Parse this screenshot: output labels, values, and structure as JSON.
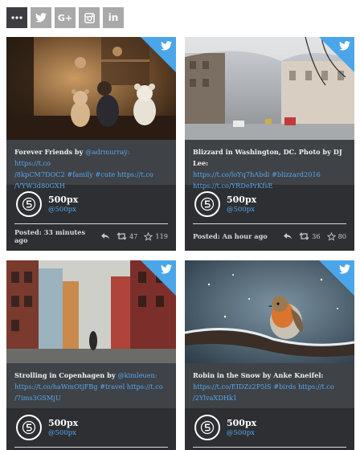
{
  "filters": [
    {
      "icon": "more-icon",
      "active": true
    },
    {
      "icon": "twitter-icon",
      "active": false
    },
    {
      "icon": "google-plus-icon",
      "active": false,
      "label": "G+"
    },
    {
      "icon": "instagram-icon",
      "active": false
    },
    {
      "icon": "linkedin-icon",
      "active": false,
      "label": "in"
    }
  ],
  "colors": {
    "accent": "#4aa6e9",
    "link": "#56a8ef",
    "card_bg": "#2d2f33",
    "text_bg": "#3f4247",
    "filter_inactive": "#a9a9a9",
    "filter_active": "#3b3d42"
  },
  "cards": [
    {
      "photo": "boy-with-teddy-bears-photo",
      "lines": [
        [
          {
            "t": "Forever Friends by ",
            "k": "plain"
          },
          {
            "t": "@adrmurray: https://t.co",
            "k": "link"
          }
        ],
        [
          {
            "t": "/8kpCM7DOC2 #family #cute https://t.co",
            "k": "link"
          }
        ],
        [
          {
            "t": "/VYW3d80GXH",
            "k": "link"
          }
        ]
      ],
      "user": {
        "name": "500px",
        "handle": "@500px"
      },
      "posted": "Posted: 33 minutes ago",
      "retweets": "47",
      "favorites": "119"
    },
    {
      "photo": "snowy-street-photo",
      "lines": [
        [
          {
            "t": "Blizzard in Washington, DC. Photo by DJ Lee:",
            "k": "plain"
          }
        ],
        [
          {
            "t": "https://t.co/loYq7hAbdi #blizzard2016",
            "k": "link"
          }
        ],
        [
          {
            "t": "https://t.co/YRDePrKfsE",
            "k": "link"
          }
        ]
      ],
      "user": {
        "name": "500px",
        "handle": "@500px"
      },
      "posted": "Posted: An hour ago",
      "retweets": "36",
      "favorites": "80"
    },
    {
      "photo": "copenhagen-street-photo",
      "lines": [
        [
          {
            "t": "Strolling in Copenhagen by ",
            "k": "plain"
          },
          {
            "t": "@kimleuen:",
            "k": "link"
          }
        ],
        [
          {
            "t": "https://t.co/haWmOtjFBg #travel https://t.co",
            "k": "link"
          }
        ],
        [
          {
            "t": "/7ims3GSMjU",
            "k": "link"
          }
        ]
      ],
      "user": {
        "name": "500px",
        "handle": "@500px"
      }
    },
    {
      "photo": "robin-in-snow-photo",
      "lines": [
        [
          {
            "t": "Robin in the Snow by Anke Kneifel:",
            "k": "plain"
          }
        ],
        [
          {
            "t": "https://t.co/EIDZz2P5lS #birds https://t.co",
            "k": "link"
          }
        ],
        [
          {
            "t": "/2YlvaXDHk1",
            "k": "link"
          }
        ]
      ],
      "user": {
        "name": "500px",
        "handle": "@500px"
      }
    }
  ]
}
